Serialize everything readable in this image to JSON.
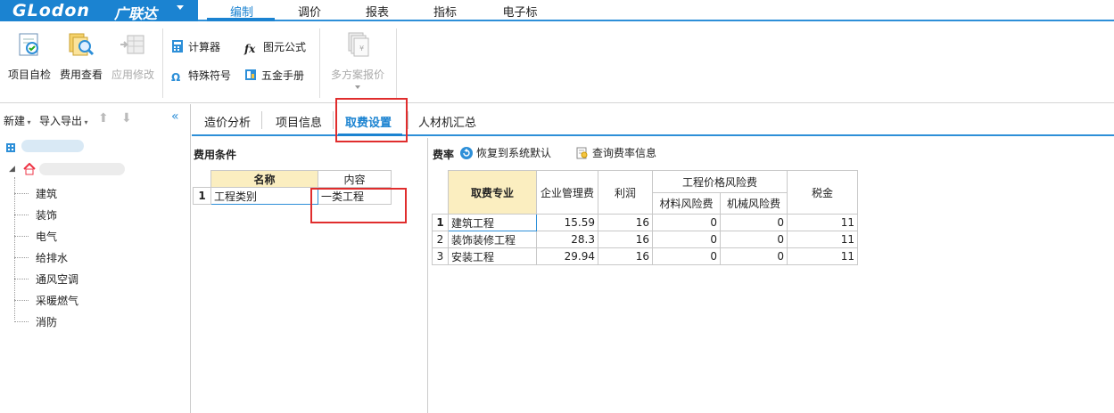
{
  "app": {
    "brand": "GLodon",
    "brand_cn": "广联达"
  },
  "menu": [
    "编制",
    "调价",
    "报表",
    "指标",
    "电子标"
  ],
  "ribbon": {
    "big": [
      {
        "label": "项目自检",
        "icon": "project-check-icon",
        "enabled": true
      },
      {
        "label": "费用查看",
        "icon": "fee-view-icon",
        "enabled": true
      },
      {
        "label": "应用修改",
        "icon": "apply-changes-icon",
        "enabled": false
      }
    ],
    "small": [
      {
        "label": "计算器",
        "icon": "calculator-icon"
      },
      {
        "label": "图元公式",
        "icon": "formula-icon"
      },
      {
        "label": "特殊符号",
        "icon": "omega-icon"
      },
      {
        "label": "五金手册",
        "icon": "handbook-icon"
      }
    ],
    "multi": {
      "label": "多方案报价",
      "enabled": false
    }
  },
  "left": {
    "new": "新建",
    "import_export": "导入导出",
    "tree": [
      "建筑",
      "装饰",
      "电气",
      "给排水",
      "通风空调",
      "采暖燃气",
      "消防"
    ]
  },
  "tabs": [
    "造价分析",
    "项目信息",
    "取费设置",
    "人材机汇总"
  ],
  "conditions": {
    "title": "费用条件",
    "headers": [
      "名称",
      "内容"
    ],
    "rows": [
      {
        "num": "1",
        "name": "工程类别",
        "value": "一类工程"
      }
    ]
  },
  "rates": {
    "title": "费率",
    "restore": "恢复到系统默认",
    "query": "查询费率信息",
    "headers": {
      "specialty": "取费专业",
      "mgmt": "企业管理费",
      "profit": "利润",
      "risk_group": "工程价格风险费",
      "material_risk": "材料风险费",
      "machine_risk": "机械风险费",
      "tax": "税金"
    },
    "rows": [
      {
        "num": "1",
        "name": "建筑工程",
        "mgmt": "15.59",
        "profit": "16",
        "mat": "0",
        "mach": "0",
        "tax": "11"
      },
      {
        "num": "2",
        "name": "装饰装修工程",
        "mgmt": "28.3",
        "profit": "16",
        "mat": "0",
        "mach": "0",
        "tax": "11"
      },
      {
        "num": "3",
        "name": "安装工程",
        "mgmt": "29.94",
        "profit": "16",
        "mat": "0",
        "mach": "0",
        "tax": "11"
      }
    ]
  },
  "colors": {
    "accent": "#1b83d1",
    "highlight": "#e02d2d",
    "header_bg": "#fbeec0"
  }
}
